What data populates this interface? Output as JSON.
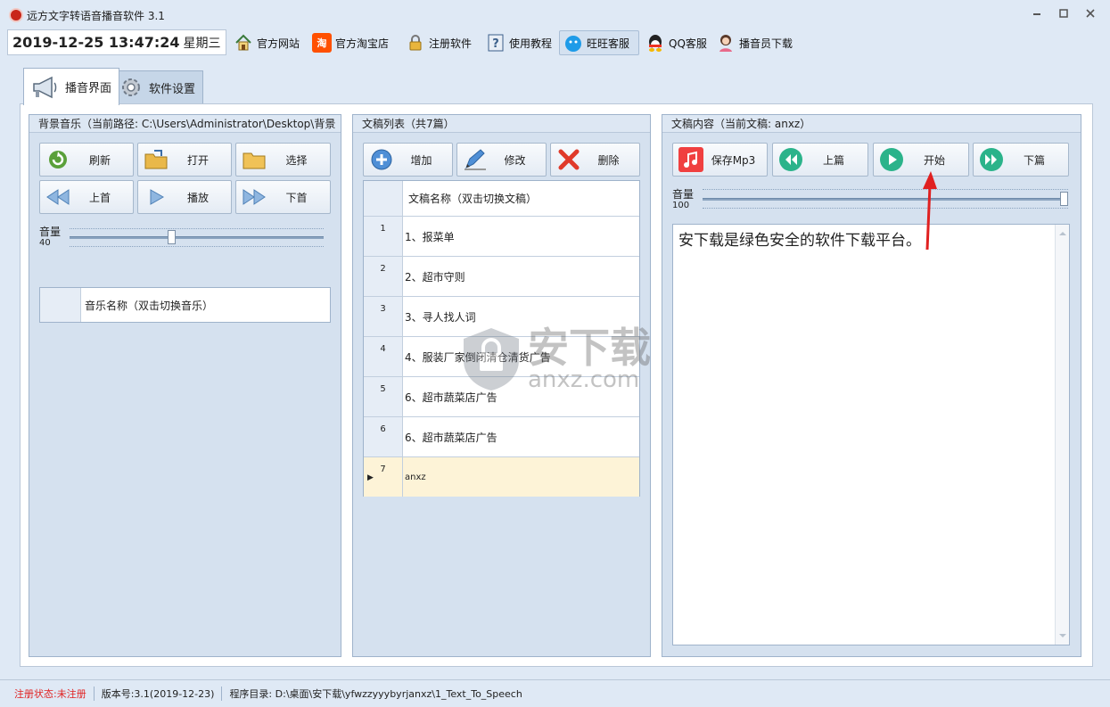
{
  "window": {
    "title": "远方文字转语音播音软件 3.1",
    "min": "▭",
    "max": "▢",
    "close": "✕"
  },
  "toolbar": {
    "date": "2019-12-25 13:47:24",
    "weekday": "星期三",
    "items": [
      {
        "label": "官方网站",
        "icon": "home-icon"
      },
      {
        "label": "官方淘宝店",
        "icon": "taobao-icon"
      },
      {
        "label": "注册软件",
        "icon": "lock-icon"
      },
      {
        "label": "使用教程",
        "icon": "help-icon"
      },
      {
        "label": "旺旺客服",
        "icon": "wangwang-icon"
      },
      {
        "label": "QQ客服",
        "icon": "qq-icon"
      },
      {
        "label": "播音员下载",
        "icon": "announcer-icon"
      }
    ],
    "taobao_glyph": "淘"
  },
  "tabs": [
    {
      "label": "播音界面",
      "icon": "megaphone-icon"
    },
    {
      "label": "软件设置",
      "icon": "gear-icon"
    }
  ],
  "music": {
    "header": "背景音乐（当前路径: C:\\Users\\Administrator\\Desktop\\背景",
    "buttons": {
      "refresh": "刷新",
      "open": "打开",
      "select": "选择",
      "prev": "上首",
      "play": "播放",
      "next": "下首"
    },
    "volume_label": "音量",
    "volume_value": "40",
    "volume_level": 0.4,
    "column": "音乐名称（双击切换音乐）"
  },
  "drafts": {
    "header": "文稿列表（共7篇）",
    "buttons": {
      "add": "增加",
      "edit": "修改",
      "delete": "删除"
    },
    "column": "文稿名称（双击切换文稿）",
    "rows": [
      {
        "num": "1",
        "name": "1、报菜单"
      },
      {
        "num": "2",
        "name": "2、超市守则"
      },
      {
        "num": "3",
        "name": "3、寻人找人词"
      },
      {
        "num": "4",
        "name": "4、服装厂家倒闭清仓清货广告"
      },
      {
        "num": "5",
        "name": "6、超市蔬菜店广告"
      },
      {
        "num": "6",
        "name": "6、超市蔬菜店广告"
      },
      {
        "num": "7",
        "name": "anxz"
      }
    ],
    "selected_marker": "▶"
  },
  "content": {
    "header": "文稿内容（当前文稿: anxz）",
    "buttons": {
      "save": "保存Mp3",
      "prev": "上篇",
      "start": "开始",
      "next": "下篇"
    },
    "volume_label": "音量",
    "volume_value": "100",
    "volume_level": 1.0,
    "text": "安下载是绿色安全的软件下载平台。"
  },
  "watermark": {
    "cn": "安下载",
    "en": "anxz.com"
  },
  "status": {
    "reg_label": "注册状态:",
    "reg_value": "未注册",
    "version": "版本号:3.1(2019-12-23)",
    "dir": "程序目录: D:\\桌面\\安下载\\yfwzzyyybyrjanxz\\1_Text_To_Speech"
  },
  "colors": {
    "accent_red": "#e02020",
    "selected_row": "#fdf3d7",
    "panel": "#d5e1ef"
  }
}
